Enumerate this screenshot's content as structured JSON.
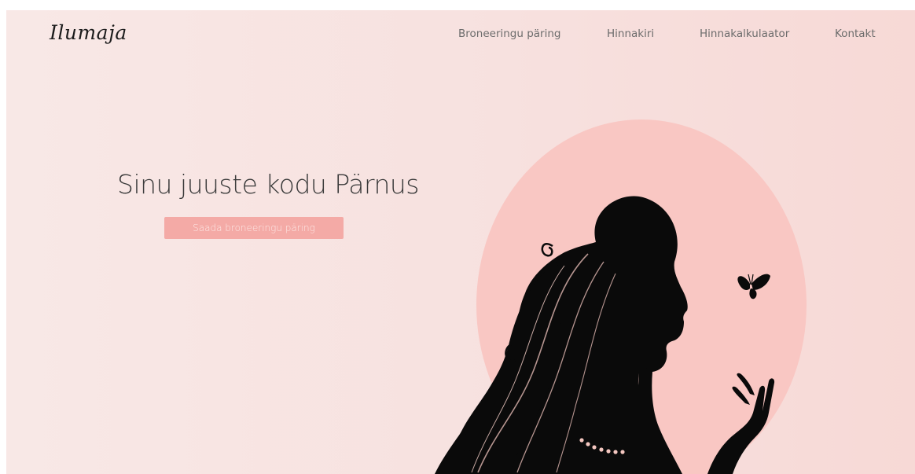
{
  "brand": {
    "logo_text": "Ilumaja"
  },
  "nav": {
    "items": [
      {
        "label": "Broneeringu päring"
      },
      {
        "label": "Hinnakiri"
      },
      {
        "label": "Hinnakalkulaator"
      },
      {
        "label": "Kontakt"
      }
    ]
  },
  "hero": {
    "title": "Sinu juuste kodu Pärnus",
    "cta_label": "Saada broneeringu päring"
  },
  "illustration": {
    "icons": [
      "woman-silhouette-icon",
      "butterfly-icon",
      "pearl-necklace-icon"
    ]
  },
  "colors": {
    "background_start": "#f8e8e6",
    "background_end": "#f7d9d6",
    "accent": "#f4aaa6",
    "oval": "#f9c7c3",
    "text_dark": "#3a3a3a",
    "nav_text": "#6c6c6c"
  }
}
